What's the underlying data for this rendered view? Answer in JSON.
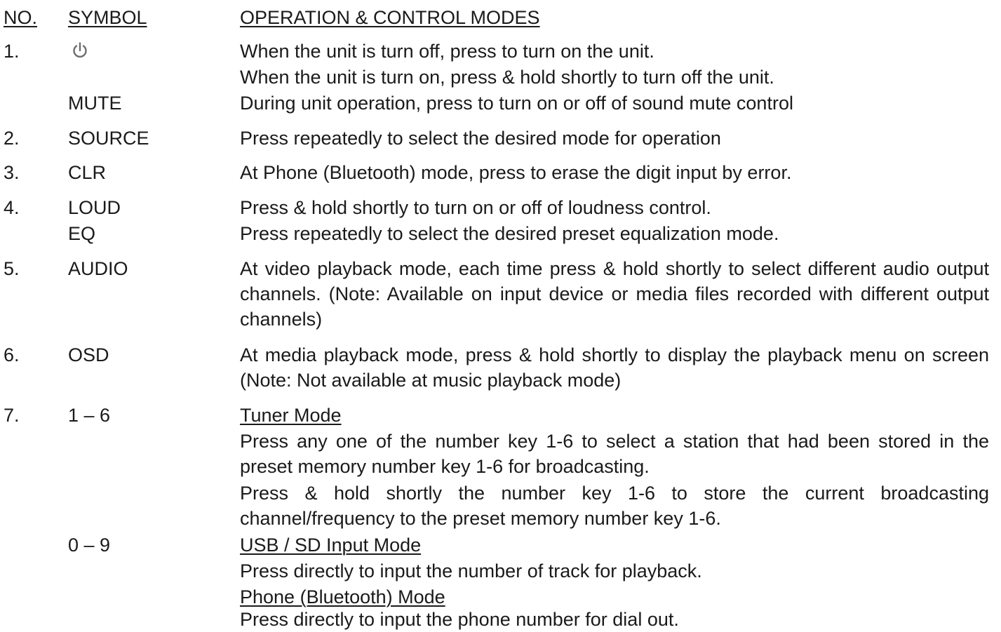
{
  "header": {
    "no": "NO.",
    "symbol": "SYMBOL",
    "operation": "OPERATION & CONTROL MODES"
  },
  "items": [
    {
      "no": "1.",
      "symbol_icon": "power-icon",
      "lines": [
        "When the unit is turn off, press to turn on the unit.",
        "When the unit is turn on, press & hold shortly to turn off the unit."
      ],
      "sub": {
        "symbol": "MUTE",
        "text": "During unit operation, press to turn on or off of sound mute control"
      }
    },
    {
      "no": "2.",
      "symbol": "SOURCE",
      "text": "Press repeatedly to select the desired mode for operation"
    },
    {
      "no": "3.",
      "symbol": "CLR",
      "text": "At Phone (Bluetooth) mode, press to erase the digit input by error."
    },
    {
      "no": "4.",
      "symbol": "LOUD",
      "text": "Press & hold shortly to turn on or off of loudness control.",
      "sub": {
        "symbol": "EQ",
        "text": "Press repeatedly to select the desired preset equalization mode."
      }
    },
    {
      "no": "5.",
      "symbol": "AUDIO",
      "text": "At video playback mode, each time press & hold shortly to select different audio output channels. (Note: Available on input device or media files recorded with different output channels)"
    },
    {
      "no": "6.",
      "symbol": "OSD",
      "text": "At media playback mode, press & hold shortly to display the playback menu on screen (Note: Not available at music playback mode)"
    },
    {
      "no": "7.",
      "symbol": "1 – 6",
      "heading": "Tuner Mode",
      "para1": "Press any one of the number key 1-6 to select a station that had been stored in the preset memory number key 1-6 for broadcasting.",
      "para2": "Press & hold shortly the number key 1-6 to store the current broadcasting channel/frequency to the preset memory number key 1-6.",
      "sub": {
        "symbol": "0 – 9",
        "heading1": "USB / SD Input Mode",
        "text1": "Press directly to input the number of track for playback.",
        "heading2": "Phone (Bluetooth) Mode",
        "text2": "Press directly to input the phone number for dial out."
      }
    }
  ]
}
